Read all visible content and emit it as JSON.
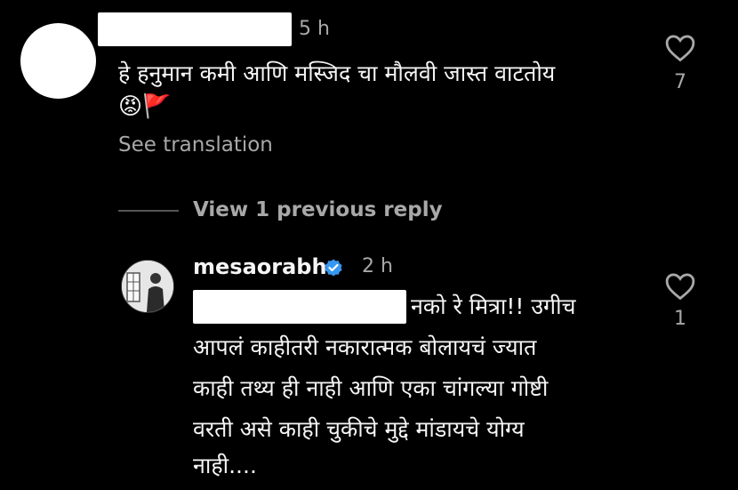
{
  "comment": {
    "time": "5 h",
    "text_line1": "हे हनुमान कमी आणि मस्जिद चा मौलवी जास्त वाटतोय",
    "emojis": "😡🚩",
    "translate": "See translation",
    "like_count": "7"
  },
  "replies": {
    "view_label": "View 1 previous reply"
  },
  "reply": {
    "username": "mesaorabh",
    "time": "2 h",
    "line1_tail": "नको रे मित्रा!! उगीच",
    "line2": "आपलं काहीतरी नकारात्मक बोलायचं ज्यात",
    "line3": "काही तथ्य ही नाही आणि एका चांगल्या गोष्टी",
    "line4": "वरती असे काही चुकीचे मुद्दे मांडायचे योग्य",
    "line5": "नाही....",
    "like_count": "1"
  },
  "colors": {
    "background": "#000000",
    "verified": "#3897f0",
    "muted": "#a8a8a8"
  }
}
